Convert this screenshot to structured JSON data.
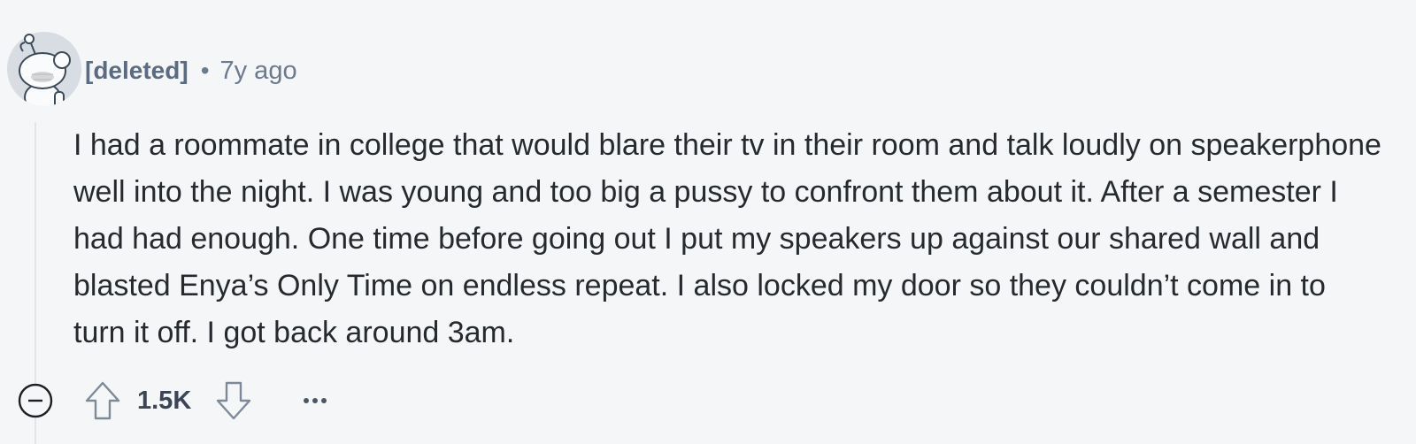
{
  "comment": {
    "author": "[deleted]",
    "separator": "•",
    "time": "7y ago",
    "body": "I had a roommate in college that would blare their tv in their room and talk loudly on speakerphone well into the night. I was young and too big a pussy to confront them about it. After a semester I had had enough. One time before going out I put my speakers up against our shared wall and blasted Enya’s Only Time on endless repeat. I also locked my door so they couldn’t come in to turn it off. I got back around 3am.",
    "score": "1.5K",
    "icons": {
      "avatar": "snoo-avatar",
      "collapse": "collapse-minus-icon",
      "upvote": "upvote-arrow-icon",
      "downvote": "downvote-arrow-icon",
      "more": "ellipsis-icon"
    }
  }
}
